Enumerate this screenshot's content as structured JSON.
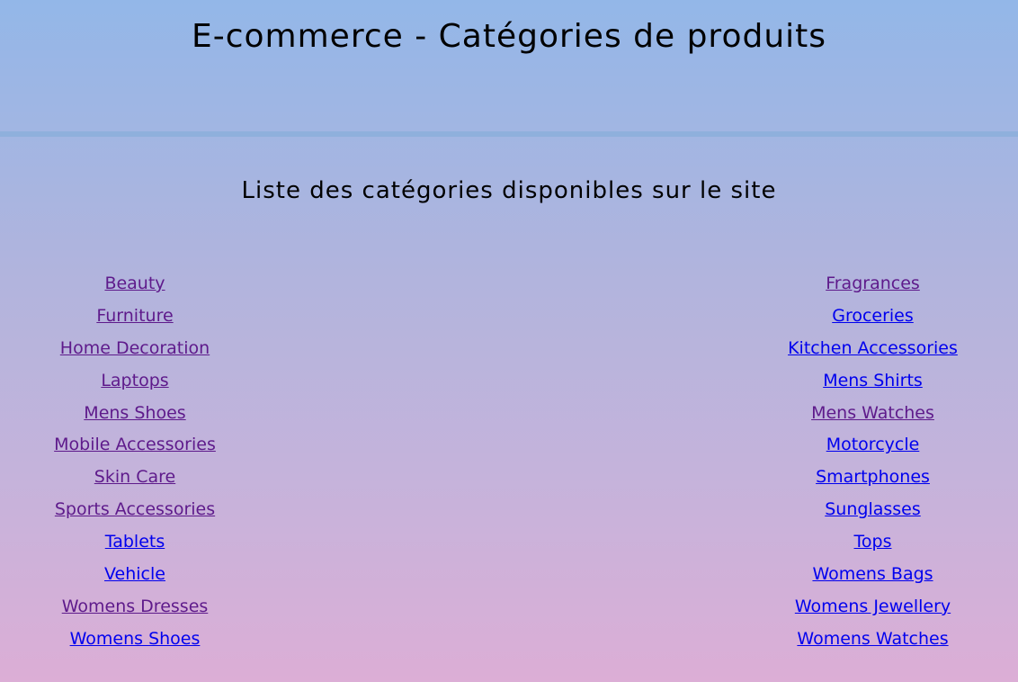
{
  "header": {
    "title": "E-commerce - Catégories de produits"
  },
  "main": {
    "subtitle": "Liste des catégories disponibles sur le site"
  },
  "colors": {
    "link_visited": "#5e1a8b",
    "link_unvisited": "#0000ee",
    "background_top": "#93b7e8",
    "background_bottom": "#dcaed6",
    "divider": "#8fb0dc"
  },
  "categories": {
    "left": [
      {
        "label": "Beauty",
        "visited": true
      },
      {
        "label": "Furniture",
        "visited": true
      },
      {
        "label": "Home Decoration",
        "visited": true
      },
      {
        "label": "Laptops",
        "visited": true
      },
      {
        "label": "Mens Shoes",
        "visited": true
      },
      {
        "label": "Mobile Accessories",
        "visited": true
      },
      {
        "label": "Skin Care",
        "visited": true
      },
      {
        "label": "Sports Accessories",
        "visited": true
      },
      {
        "label": "Tablets",
        "visited": false
      },
      {
        "label": "Vehicle",
        "visited": false
      },
      {
        "label": "Womens Dresses",
        "visited": true
      },
      {
        "label": "Womens Shoes",
        "visited": false
      }
    ],
    "right": [
      {
        "label": "Fragrances",
        "visited": true
      },
      {
        "label": "Groceries",
        "visited": false
      },
      {
        "label": "Kitchen Accessories",
        "visited": false
      },
      {
        "label": "Mens Shirts",
        "visited": false
      },
      {
        "label": "Mens Watches",
        "visited": true
      },
      {
        "label": "Motorcycle",
        "visited": false
      },
      {
        "label": "Smartphones",
        "visited": false
      },
      {
        "label": "Sunglasses",
        "visited": false
      },
      {
        "label": "Tops",
        "visited": false
      },
      {
        "label": "Womens Bags",
        "visited": false
      },
      {
        "label": "Womens Jewellery",
        "visited": false
      },
      {
        "label": "Womens Watches",
        "visited": false
      }
    ]
  }
}
